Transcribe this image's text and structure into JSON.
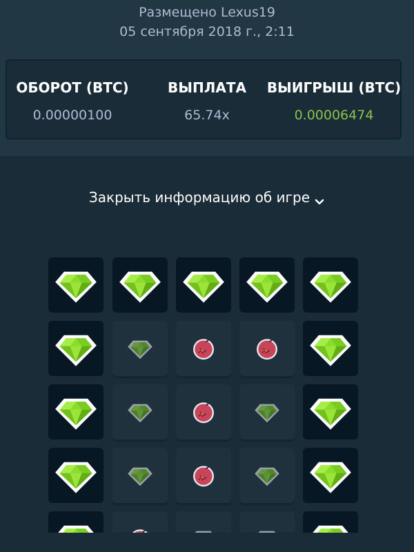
{
  "header": {
    "placed_by": "Размещено Lexus19",
    "date": "05 сентября 2018 г., 2:11"
  },
  "stats": [
    {
      "label": "ОБОРОТ (BTC)",
      "value": "0.00000100"
    },
    {
      "label": "ВЫПЛАТА",
      "value": "65.74x"
    },
    {
      "label": "ВЫИГРЫШ (BTC)",
      "value": "0.00006474"
    }
  ],
  "colors": {
    "win_value": "#8bc34a",
    "gem": "#8cdc2c",
    "mine": "#c8445a"
  },
  "close_info_label": "Закрыть информацию об игре",
  "board": {
    "rows": [
      [
        "gem",
        "gem",
        "gem",
        "gem",
        "gem"
      ],
      [
        "gem",
        "gem-dim",
        "mine-dim",
        "mine-dim",
        "gem"
      ],
      [
        "gem",
        "gem-dim",
        "mine-dim",
        "gem-dim",
        "gem"
      ],
      [
        "gem",
        "gem-dim",
        "mine-dim",
        "gem-dim",
        "gem"
      ],
      [
        "gem",
        "mine-dim",
        "gem-dim",
        "gem-dim",
        "gem"
      ]
    ]
  }
}
